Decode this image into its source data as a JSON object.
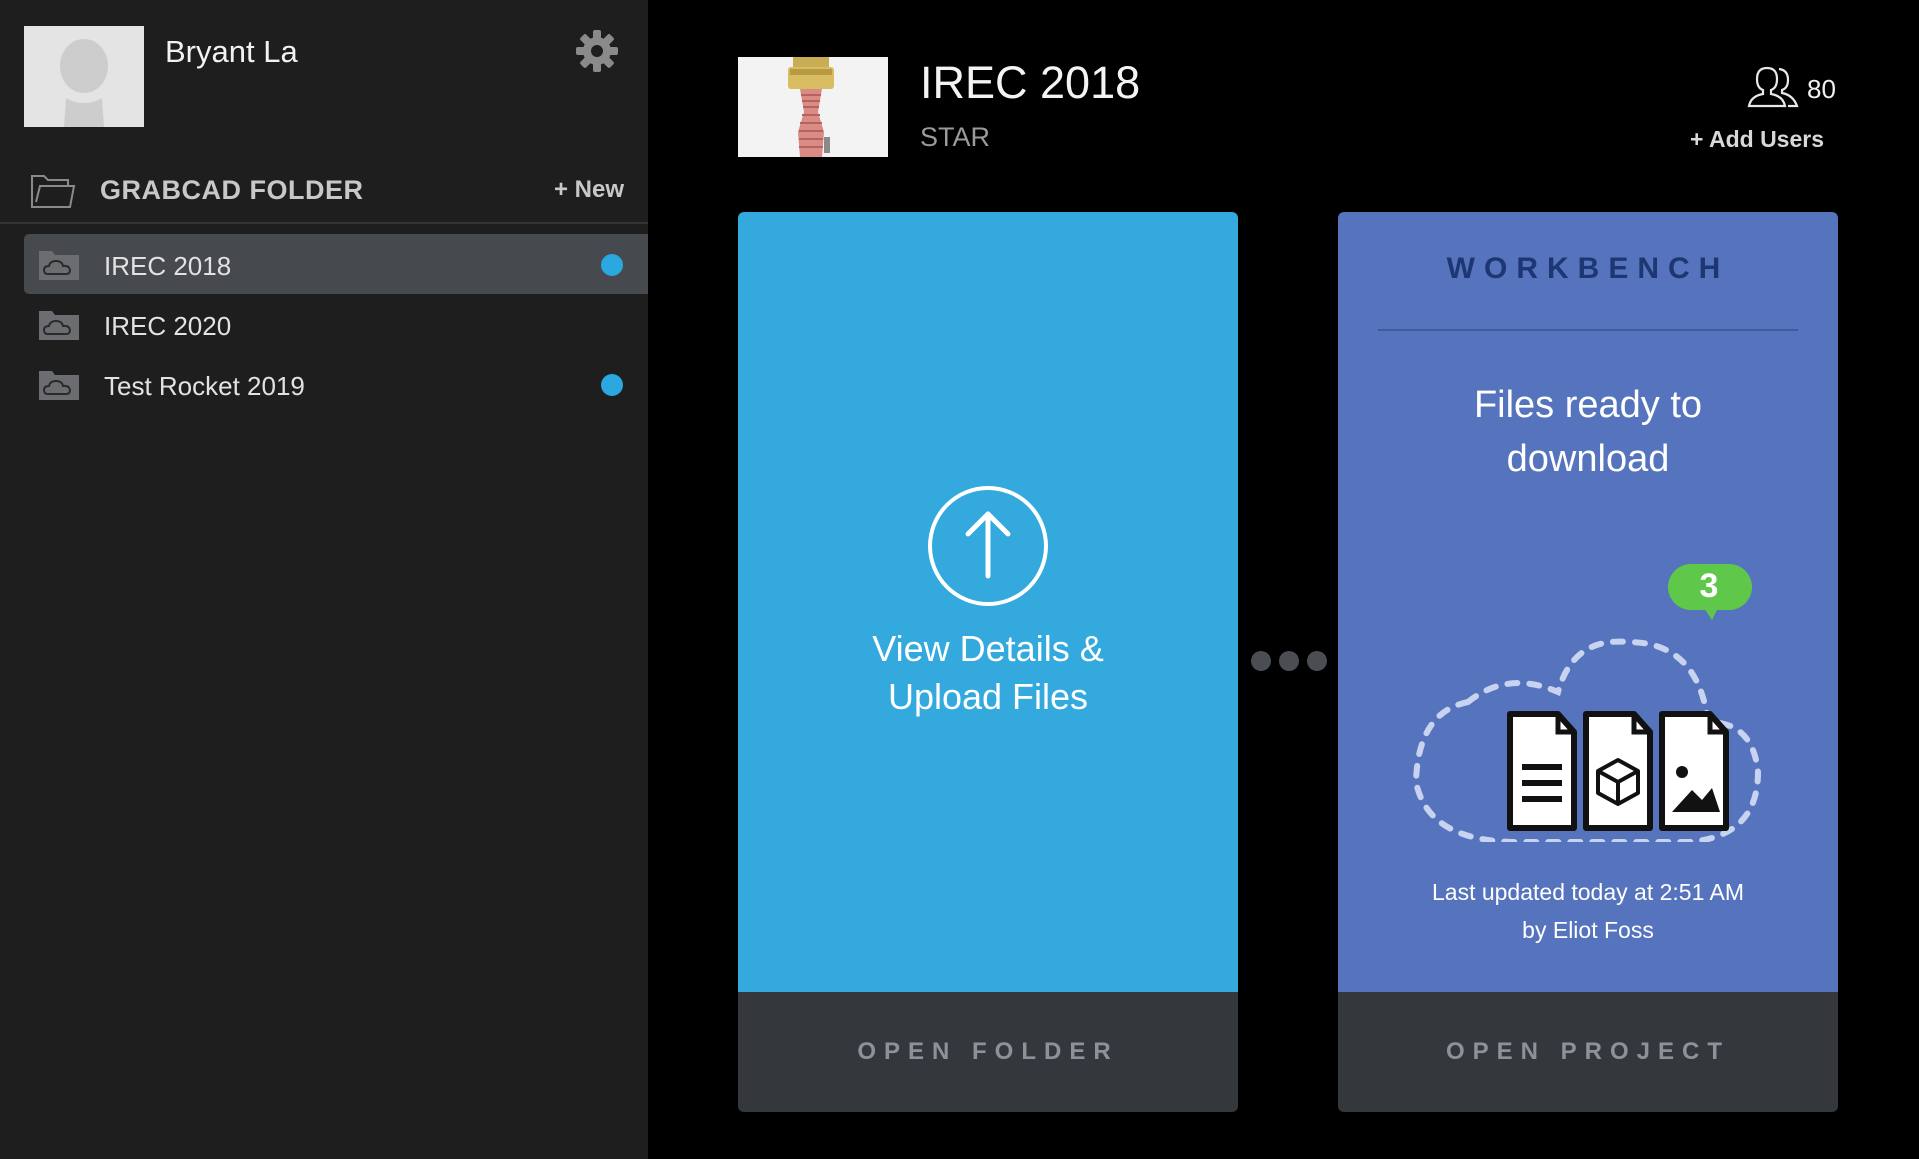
{
  "sidebar": {
    "user_name": "Bryant La",
    "avatar_icon": "user-silhouette-icon",
    "settings_icon": "gear-icon",
    "folder_header": {
      "icon": "folder-outline-icon",
      "title": "GRABCAD FOLDER",
      "new_label": "+ New"
    },
    "folders": [
      {
        "label": "IREC 2018",
        "icon": "cloud-folder-icon",
        "active": true,
        "unread": true
      },
      {
        "label": "IREC 2020",
        "icon": "cloud-folder-icon",
        "active": false,
        "unread": false
      },
      {
        "label": "Test Rocket 2019",
        "icon": "cloud-folder-icon",
        "active": false,
        "unread": true
      }
    ]
  },
  "project": {
    "title": "IREC 2018",
    "subtitle": "STAR",
    "thumbnail_icon": "rocket-model-thumbnail",
    "users_icon": "users-icon",
    "user_count": "80",
    "add_users_label": "+ Add Users"
  },
  "folder_card": {
    "icon": "upload-arrow-icon",
    "line1": "View Details &",
    "line2": "Upload Files",
    "footer": "OPEN FOLDER"
  },
  "project_card": {
    "heading": "WORKBENCH",
    "ready_line1": "Files ready to",
    "ready_line2": "download",
    "badge_count": "3",
    "file_icons": [
      "document-icon",
      "cube-icon",
      "image-icon"
    ],
    "updated_line1": "Last updated today at 2:51 AM",
    "updated_line2": "by Eliot Foss",
    "footer": "OPEN PROJECT"
  },
  "colors": {
    "sidebar_bg": "#1e1e1f",
    "active_item_bg": "#46494d",
    "unread_dot": "#2ba8e0",
    "folder_card_bg": "#33a9de",
    "project_card_bg": "#5674bd",
    "card_footer_bg": "#34373c",
    "badge_green": "#5fc84a"
  }
}
